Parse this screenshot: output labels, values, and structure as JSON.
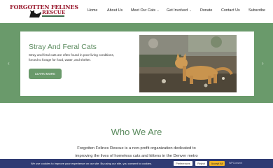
{
  "logo": {
    "line1": "FORGOTTEN FELINES",
    "line2": "RESCUE"
  },
  "nav": {
    "items": [
      {
        "label": "Home"
      },
      {
        "label": "About Us"
      },
      {
        "label": "Meet Our Cats"
      },
      {
        "label": "Get Involved"
      },
      {
        "label": "Donate"
      },
      {
        "label": "Contact Us"
      },
      {
        "label": "Subscribe"
      }
    ]
  },
  "hero": {
    "title": "Stray And Feral Cats",
    "description": "Stray and feral cats are often found in poor living conditions, forced to forage for food, water, and shelter.",
    "button_label": "LEARN MORE",
    "prev_arrow": "‹",
    "next_arrow": "›"
  },
  "who": {
    "title": "Who We Are",
    "line1": "Forgotten Felines Rescue is a non-profit organization dedicated to",
    "line2": "improving the lives of homeless cats and kittens in the Denver metro"
  },
  "cookie": {
    "text": "We use cookies to improve your experience on our site. By using our site, you consent to cookies.",
    "preferences_label": "Preferences",
    "reject_label": "Reject",
    "accept_label": "Accept All",
    "brand": "WPConsent"
  },
  "colors": {
    "brand_red": "#9a1b2f",
    "green": "#6a9a6b",
    "cookie_bar": "#2f3b73",
    "accept": "#f0b429"
  }
}
